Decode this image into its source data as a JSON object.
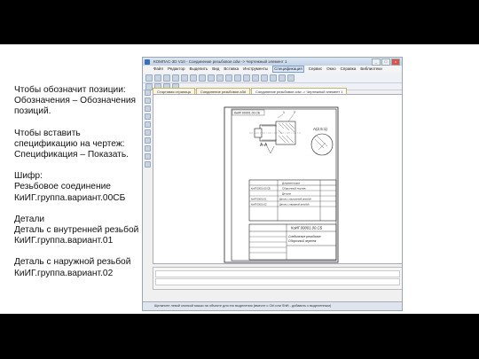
{
  "notes": [
    "Чтобы обозначит позиции:\nОбозначения – Обозначения позиций.",
    "Чтобы вставить спецификацию на чертеж:\nСпецификация – Показать.",
    "Шифр:\nРезьбовое соединение\nКиИГ.группа.вариант.00СБ",
    "Детали\nДеталь с внутренней резьбой\nКиИГ.группа.вариант.01",
    "Деталь с наружной резьбой\nКиИГ.группа.вариант.02"
  ],
  "window": {
    "title": "КОМПАС-3D V10 - Соединение резьбовое.cdw -> Чертежный элемент 1",
    "buttons": [
      "_",
      "□",
      "×"
    ]
  },
  "menu": [
    "Файл",
    "Редактор",
    "Выделить",
    "Вид",
    "Вставка",
    "Инструменты",
    "Спецификация",
    "Сервис",
    "Окно",
    "Справка",
    "Библиотеки"
  ],
  "menu_active_index": 6,
  "tabs": [
    "Стартовая страница",
    "Соединение резьбовое.a3d",
    "Соединение резьбовое.cdw -> Чертежный элемент 1"
  ],
  "tab_active_index": 2,
  "drawing": {
    "stamp": "КиИГ.00001.00.СБ",
    "section": "А-А",
    "view": "А(2,5:1)",
    "positions": [
      "1",
      "2"
    ],
    "spec_rows": [
      "Документация",
      "Сборочный чертеж",
      "Детали",
      "Деталь с внутренней резьбой",
      "Деталь с наружной резьбой"
    ],
    "spec_codes": [
      "КиИГ.00001.00.СБ",
      "КиИГ.00001.01",
      "КиИГ.00001.02"
    ],
    "title_code": "КиИГ.00001.00.СБ",
    "title_name": "Соединение резьбовое",
    "title_subname": "Сборочный чертеж"
  },
  "status": "Щелкните левой кнопкой мыши на объекте для его выделения (вместе с Ctrl или Shift - добавить к выделенным)"
}
